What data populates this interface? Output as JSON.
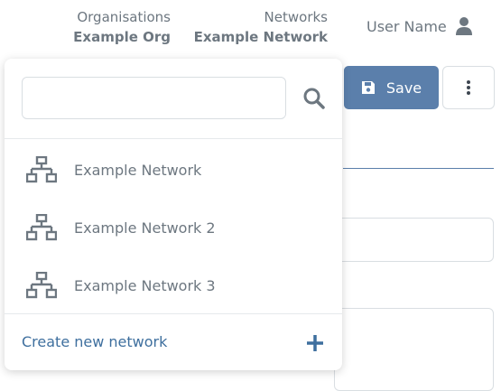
{
  "header": {
    "organisations_label": "Organisations",
    "organisation_value": "Example Org",
    "networks_label": "Networks",
    "network_value": "Example Network",
    "user_name": "User Name"
  },
  "toolbar": {
    "save_label": "Save"
  },
  "dropdown": {
    "search_placeholder": "",
    "items": [
      {
        "label": "Example Network",
        "icon": "network-icon"
      },
      {
        "label": "Example Network 2",
        "icon": "network-icon"
      },
      {
        "label": "Example Network 3",
        "icon": "network-icon"
      }
    ],
    "create_label": "Create new network"
  },
  "colors": {
    "accent": "#5b7fab",
    "link": "#3e6f9e",
    "text": "#6d7780"
  }
}
